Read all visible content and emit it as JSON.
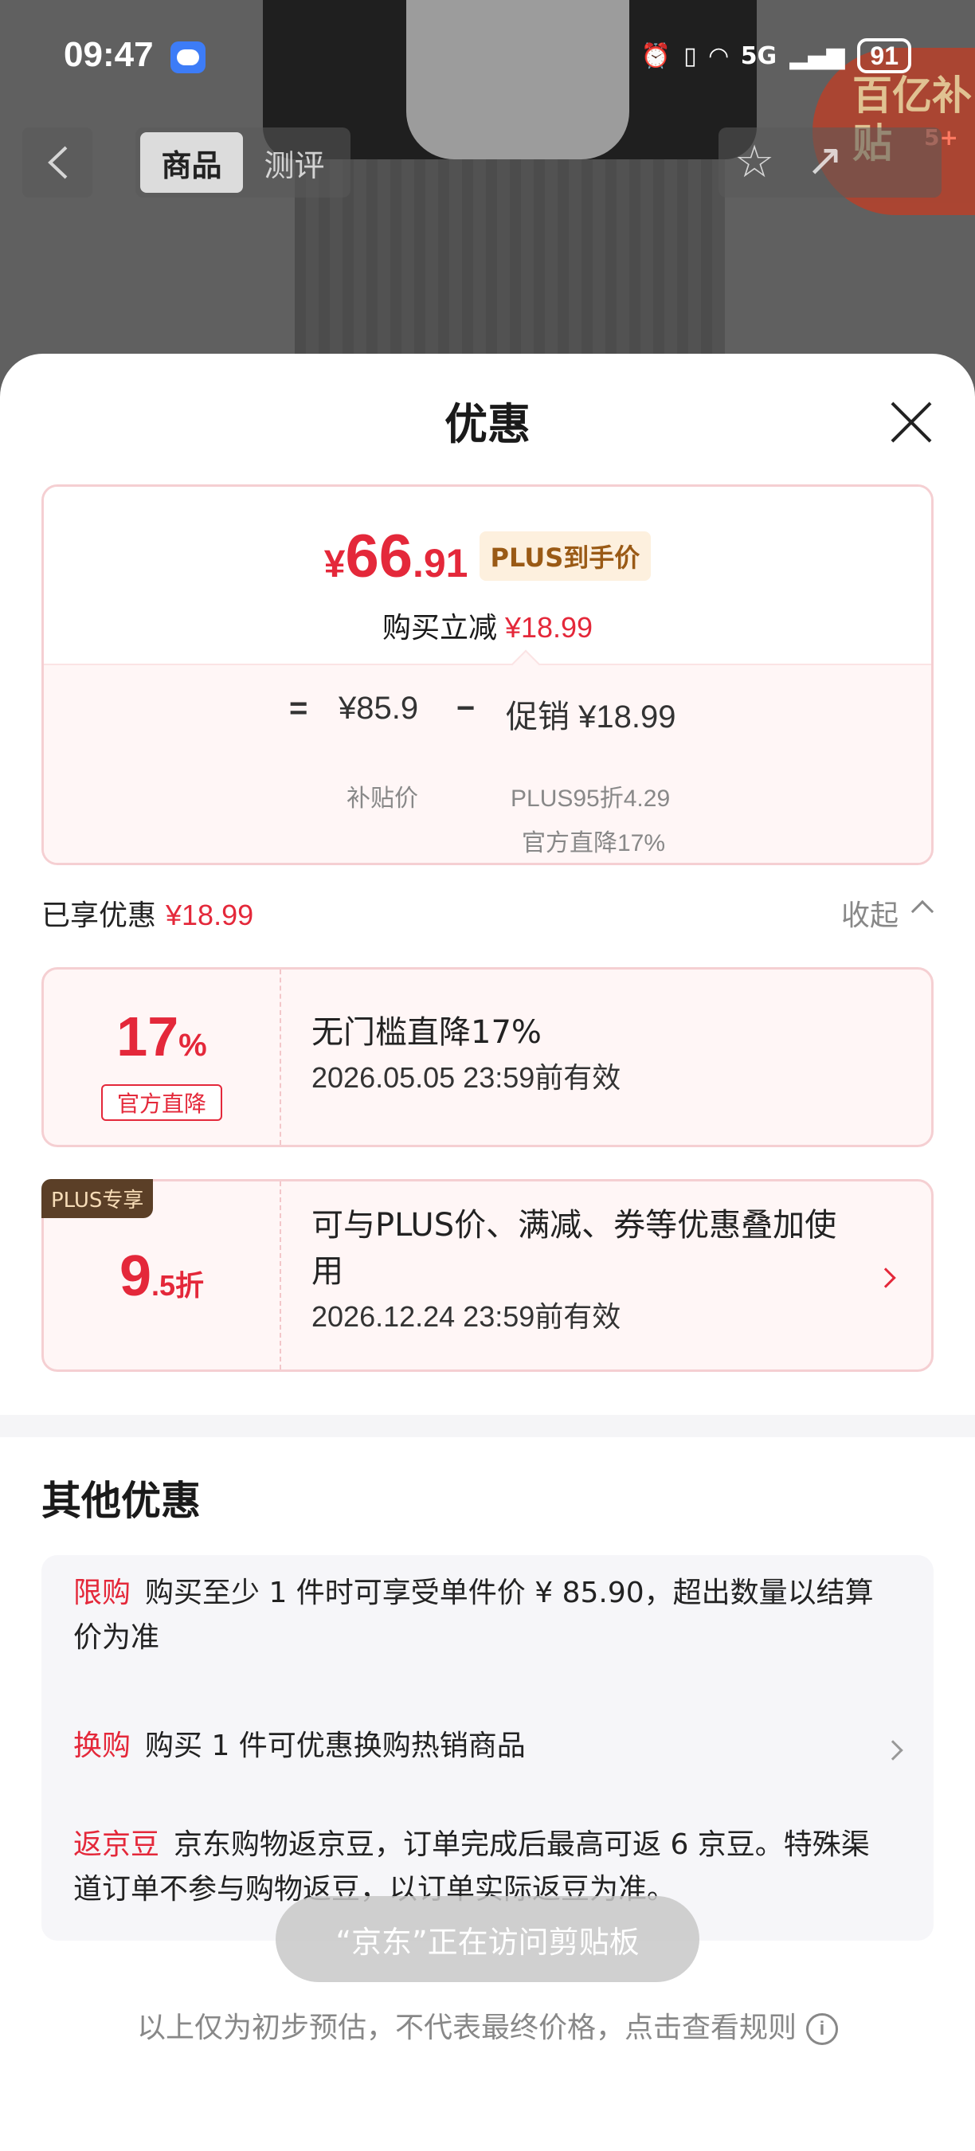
{
  "status_bar": {
    "time": "09:47",
    "network": "5G",
    "battery": "91"
  },
  "background_page": {
    "tabs": [
      "商品",
      "测评"
    ],
    "promo_badge": "百亿补贴",
    "promo_count": "5+"
  },
  "sheet": {
    "title": "优惠"
  },
  "price_card": {
    "currency": "¥",
    "price_int": "66",
    "price_dec": ".91",
    "plus_tag": "PLUS到手价",
    "cut_label": "购买立减",
    "cut_value": "¥18.99",
    "eq": "=",
    "base_price": "¥85.9",
    "minus": "−",
    "promo_text": "促销 ¥18.99",
    "base_label": "补贴价",
    "promo_detail_1": "PLUS95折4.29",
    "promo_detail_2": "官方直降17%"
  },
  "enjoyed": {
    "label": "已享优惠",
    "value": "¥18.99",
    "collapse_label": "收起"
  },
  "coupons": [
    {
      "big_num": "17",
      "big_unit": "%",
      "tag": "官方直降",
      "title": "无门槛直降17%",
      "date": "2026.05.05 23:59前有效"
    },
    {
      "badge": "PLUS专享",
      "big_num": "9",
      "big_unit": ".5折",
      "title": "可与PLUS价、满减、券等优惠叠加使用",
      "date": "2026.12.24 23:59前有效"
    }
  ],
  "other": {
    "title": "其他优惠",
    "items": [
      {
        "label": "限购",
        "text": "购买至少 1 件时可享受单件价 ¥ 85.90，超出数量以结算价为准"
      },
      {
        "label": "换购",
        "text": "购买 1 件可优惠换购热销商品"
      },
      {
        "label": "返京豆",
        "text": "京东购物返京豆，订单完成后最高可返 6 京豆。特殊渠道订单不参与购物返豆，以订单实际返豆为准。"
      }
    ]
  },
  "toast": "“京东”正在访问剪贴板",
  "footnote": "以上仅为初步预估，不代表最终价格，点击查看规则",
  "colors": {
    "accent_red": "#e4283a",
    "plus_brown": "#5b3f27",
    "card_bg": "#fff6f6"
  }
}
